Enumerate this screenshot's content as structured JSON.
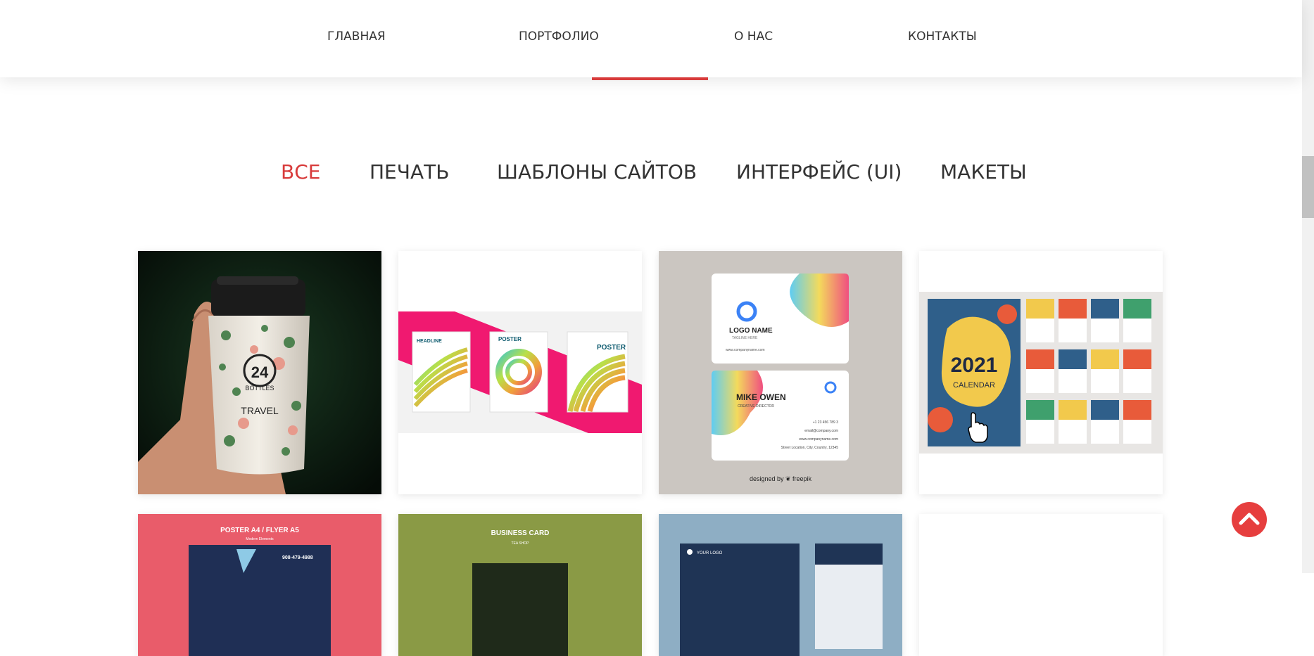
{
  "nav": {
    "items": [
      {
        "label": "ГЛАВНАЯ"
      },
      {
        "label": "ПОРТФОЛИО"
      },
      {
        "label": "О НАС"
      },
      {
        "label": "КОНТАКТЫ"
      }
    ]
  },
  "filters": {
    "items": [
      {
        "label": "ВСЕ"
      },
      {
        "label": "ПЕЧАТЬ"
      },
      {
        "label": "ШАБЛОНЫ САЙТОВ"
      },
      {
        "label": "ИНТЕРФЕЙС (UI)"
      },
      {
        "label": "МАКЕТЫ"
      }
    ],
    "active_color": "#d83b3b"
  },
  "portfolio": {
    "items": [
      {
        "name": "travel-mug-photo",
        "texts": {
          "brand_num": "24",
          "brand_name": "BOTTLES",
          "subtitle": "TRAVEL"
        }
      },
      {
        "name": "poster-set",
        "texts": {
          "headline": "HEADLINE",
          "poster_a": "POSTER",
          "poster_b": "POSTER"
        }
      },
      {
        "name": "business-card-logo",
        "texts": {
          "logo": "LOGO NAME",
          "tagline": "TAGLINE HERE",
          "site": "www.companyname.com",
          "person": "MIKE OWEN",
          "role": "CREATIVE DIRECTOR",
          "phone": "+1 23 456 789 3",
          "email": "email@company.com",
          "site2": "www.companyname.com",
          "address": "Street Location, City, Country, 12345",
          "credit": "designed by ❦ freepik"
        }
      },
      {
        "name": "calendar-2021",
        "texts": {
          "year": "2021",
          "title": "CALENDAR"
        }
      },
      {
        "name": "poster-flyer",
        "texts": {
          "title": "POSTER A4 / FLYER A5",
          "sub": "Modern Elements",
          "phone": "908-479-4988"
        }
      },
      {
        "name": "business-card-tea",
        "texts": {
          "title": "BUSINESS CARD",
          "sub": "TEA SHOP"
        }
      },
      {
        "name": "business-card-blue",
        "texts": {
          "logo": "YOUR LOGO"
        }
      },
      {
        "name": "blank-tile",
        "texts": {}
      }
    ]
  },
  "colors": {
    "accent": "#d83b3b",
    "scroll_top": "#e63e3e"
  },
  "icons": {
    "scroll_top": "chevron-up-icon",
    "cursor": "hand-pointer-icon"
  }
}
